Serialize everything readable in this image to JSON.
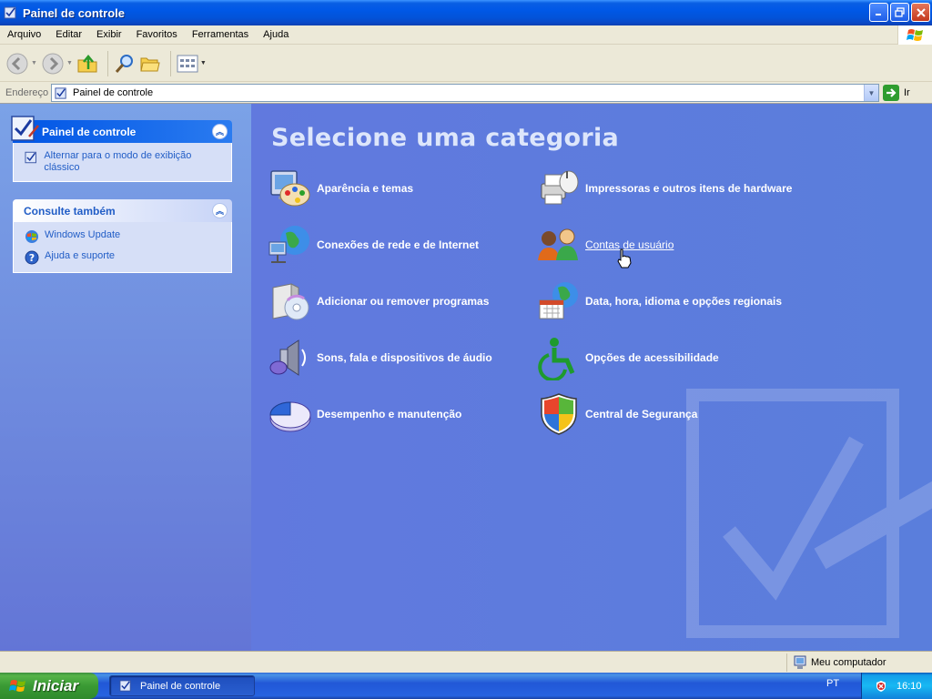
{
  "window": {
    "title": "Painel de controle"
  },
  "menu": [
    "Arquivo",
    "Editar",
    "Exibir",
    "Favoritos",
    "Ferramentas",
    "Ajuda"
  ],
  "address": {
    "label": "Endereço",
    "value": "Painel de controle",
    "go_label": "Ir"
  },
  "sidebar": {
    "panel_title": "Painel de controle",
    "panel_link": "Alternar para o modo de exibição clássico",
    "see_also_title": "Consulte também",
    "see_also_links": [
      "Windows Update",
      "Ajuda e suporte"
    ]
  },
  "main": {
    "heading": "Selecione uma categoria",
    "categories": [
      {
        "label": "Aparência e temas",
        "icon": "palette-icon"
      },
      {
        "label": "Conexões de rede e de Internet",
        "icon": "network-globe-icon"
      },
      {
        "label": "Adicionar ou remover programas",
        "icon": "cd-box-icon"
      },
      {
        "label": "Sons, fala e dispositivos de áudio",
        "icon": "speaker-icon"
      },
      {
        "label": "Desempenho e manutenção",
        "icon": "pie-chart-icon"
      },
      {
        "label": "Impressoras e outros itens de hardware",
        "icon": "printer-icon"
      },
      {
        "label": "Contas de usuário",
        "icon": "users-icon"
      },
      {
        "label": "Data, hora, idioma e opções regionais",
        "icon": "calendar-globe-icon"
      },
      {
        "label": "Opções de acessibilidade",
        "icon": "accessibility-icon"
      },
      {
        "label": "Central de Segurança",
        "icon": "shield-icon"
      }
    ]
  },
  "status": {
    "zone": "Meu computador"
  },
  "taskbar": {
    "start": "Iniciar",
    "task": "Painel de controle",
    "language": "PT",
    "clock": "16:10"
  },
  "colors": {
    "title_bar": "#0058e6",
    "main_pane": "#5a7edc",
    "sidebar_link": "#215dc6",
    "start_button": "#3a9a34"
  }
}
